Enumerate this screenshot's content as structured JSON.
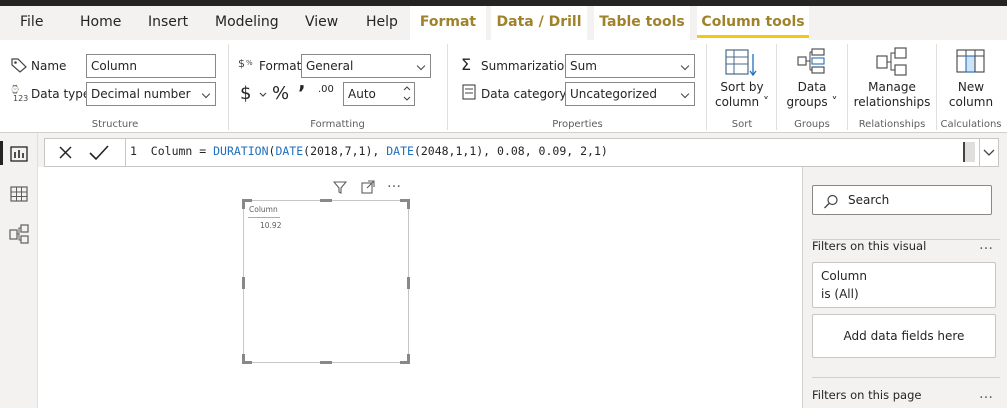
{
  "menu": {
    "file": "File",
    "home": "Home",
    "insert": "Insert",
    "modeling": "Modeling",
    "view": "View",
    "help": "Help",
    "format": "Format",
    "data_drill": "Data / Drill",
    "table_tools": "Table tools",
    "column_tools": "Column tools"
  },
  "structure": {
    "name_label": "Name",
    "name_value": "Column",
    "datatype_label": "Data type",
    "datatype_value": "Decimal number",
    "group_label": "Structure"
  },
  "formatting": {
    "format_label": "Format",
    "format_value": "General",
    "currency_symbol": "$",
    "percent_symbol": "%",
    "comma_symbol": "ʼ",
    "decimal_symbol": ".00",
    "auto_value": "Auto",
    "group_label": "Formatting"
  },
  "properties": {
    "summarization_label": "Summarization",
    "summarization_value": "Sum",
    "category_label": "Data category",
    "category_value": "Uncategorized",
    "group_label": "Properties"
  },
  "sort": {
    "line1": "Sort by",
    "line2": "column",
    "group_label": "Sort"
  },
  "groups": {
    "line1": "Data",
    "line2": "groups",
    "group_label": "Groups"
  },
  "relationships": {
    "line1": "Manage",
    "line2": "relationships",
    "group_label": "Relationships"
  },
  "calculations": {
    "line1": "New",
    "line2": "column",
    "group_label": "Calculations"
  },
  "formula": {
    "line_number": "1",
    "part1": "Column = ",
    "fn1": "DURATION",
    "part2": "(",
    "fn2": "DATE",
    "part3": "(2018,7,1), ",
    "fn3": "DATE",
    "part4": "(2048,1,1), 0.08, 0.09, 2,1)"
  },
  "visual": {
    "title": "Column",
    "value": "10.92"
  },
  "filters": {
    "search_placeholder": "Search",
    "on_visual": "Filters on this visual",
    "field_name": "Column",
    "field_state": "is (All)",
    "add_fields": "Add data fields here",
    "on_page": "Filters on this page",
    "more": "…"
  },
  "colors": {
    "accent": "#a0822b",
    "underline": "#f2c811",
    "dax_function": "#1f6fbd"
  }
}
